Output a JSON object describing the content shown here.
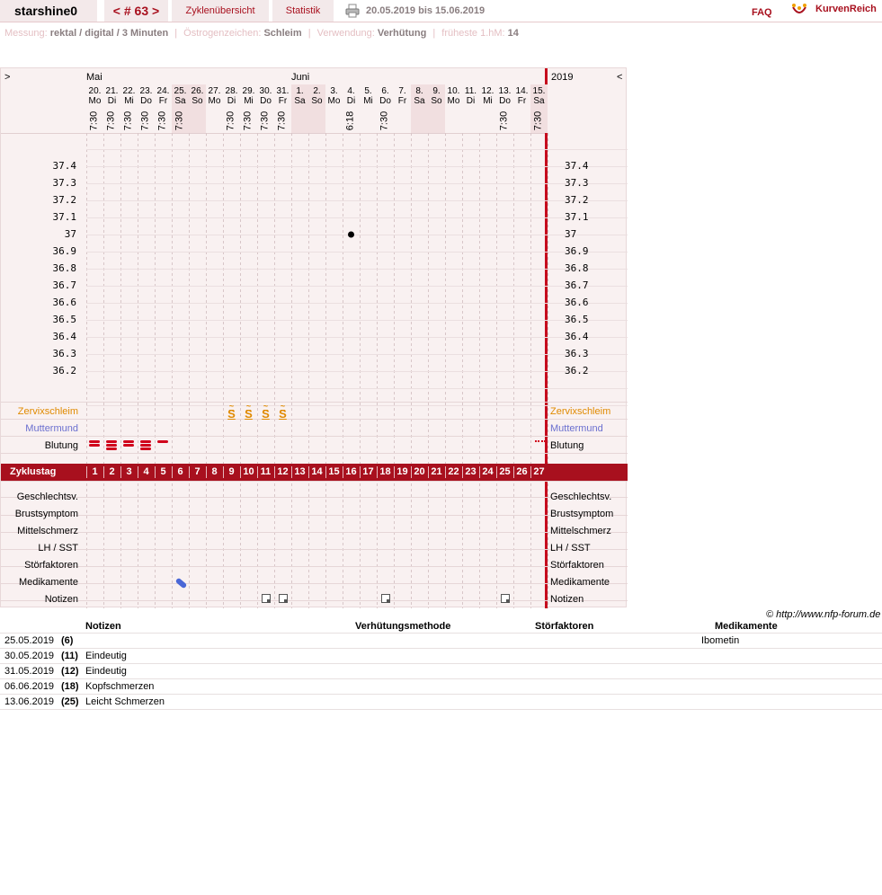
{
  "header": {
    "user": "starshine0",
    "cycle_label": "< # 63 >",
    "overview_tab": "Zyklenübersicht",
    "stats_tab": "Statistik",
    "date_range": "20.05.2019 bis 15.06.2019",
    "faq": "FAQ",
    "brand": "KurvenReich"
  },
  "info": {
    "measurement_label": "Messung:",
    "measurement_value": "rektal / digital / 3 Minuten",
    "estrogen_label": "Östrogenzeichen:",
    "estrogen_value": "Schleim",
    "usage_label": "Verwendung:",
    "usage_value": "Verhütung",
    "earliest_label": "früheste 1.hM:",
    "earliest_value": "14"
  },
  "chart": {
    "nav_prev": ">",
    "nav_next": "<",
    "months": [
      "Mai",
      "Juni"
    ],
    "year": "2019",
    "days": [
      {
        "d": "20.",
        "w": "Mo",
        "t": "7:30",
        "we": false
      },
      {
        "d": "21.",
        "w": "Di",
        "t": "7:30",
        "we": false
      },
      {
        "d": "22.",
        "w": "Mi",
        "t": "7:30",
        "we": false
      },
      {
        "d": "23.",
        "w": "Do",
        "t": "7:30",
        "we": false
      },
      {
        "d": "24.",
        "w": "Fr",
        "t": "7:30",
        "we": false
      },
      {
        "d": "25.",
        "w": "Sa",
        "t": "7:30",
        "we": true
      },
      {
        "d": "26.",
        "w": "So",
        "t": "",
        "we": true
      },
      {
        "d": "27.",
        "w": "Mo",
        "t": "",
        "we": false
      },
      {
        "d": "28.",
        "w": "Di",
        "t": "7:30",
        "we": false
      },
      {
        "d": "29.",
        "w": "Mi",
        "t": "7:30",
        "we": false
      },
      {
        "d": "30.",
        "w": "Do",
        "t": "7:30",
        "we": false
      },
      {
        "d": "31.",
        "w": "Fr",
        "t": "7:30",
        "we": false
      },
      {
        "d": "1.",
        "w": "Sa",
        "t": "",
        "we": true
      },
      {
        "d": "2.",
        "w": "So",
        "t": "",
        "we": true
      },
      {
        "d": "3.",
        "w": "Mo",
        "t": "",
        "we": false
      },
      {
        "d": "4.",
        "w": "Di",
        "t": "6:18",
        "we": false
      },
      {
        "d": "5.",
        "w": "Mi",
        "t": "",
        "we": false
      },
      {
        "d": "6.",
        "w": "Do",
        "t": "7:30",
        "we": false
      },
      {
        "d": "7.",
        "w": "Fr",
        "t": "",
        "we": false
      },
      {
        "d": "8.",
        "w": "Sa",
        "t": "",
        "we": true
      },
      {
        "d": "9.",
        "w": "So",
        "t": "",
        "we": true
      },
      {
        "d": "10.",
        "w": "Mo",
        "t": "",
        "we": false
      },
      {
        "d": "11.",
        "w": "Di",
        "t": "",
        "we": false
      },
      {
        "d": "12.",
        "w": "Mi",
        "t": "",
        "we": false
      },
      {
        "d": "13.",
        "w": "Do",
        "t": "7:30",
        "we": false
      },
      {
        "d": "14.",
        "w": "Fr",
        "t": "",
        "we": false
      },
      {
        "d": "15.",
        "w": "Sa",
        "t": "7:30",
        "we": true
      }
    ],
    "temp_ticks": [
      "37.4",
      "37.3",
      "37.2",
      "37.1",
      "37",
      "36.9",
      "36.8",
      "36.7",
      "36.6",
      "36.5",
      "36.4",
      "36.3",
      "36.2"
    ],
    "temperatures": [
      {
        "day": 16,
        "value": 37.0
      }
    ],
    "cervix_label": "Zervixschleim",
    "cervix_symbol": "S",
    "cervix_days": [
      9,
      10,
      11,
      12
    ],
    "os_label": "Muttermund",
    "bleeding_label": "Blutung",
    "bleeding": [
      {
        "day": 1,
        "level": 2
      },
      {
        "day": 2,
        "level": 3
      },
      {
        "day": 3,
        "level": 2
      },
      {
        "day": 4,
        "level": 3
      },
      {
        "day": 5,
        "level": 1
      },
      {
        "day": 27,
        "level": 0
      }
    ],
    "cycle_day_label": "Zyklustag",
    "bottom_rows": [
      "Geschlechtsv.",
      "Brustsymptom",
      "Mittelschmerz",
      "LH / SST",
      "Störfaktoren",
      "Medikamente",
      "Notizen"
    ],
    "medication_days": [
      6
    ],
    "note_days": [
      11,
      12,
      18,
      25
    ],
    "colors": {
      "accent": "#a8101e",
      "cervix": "#e08a00",
      "os": "#6a6fcf",
      "blood": "#d0021b",
      "pill": "#4a67d6"
    }
  },
  "copyright": "© http://www.nfp-forum.de",
  "notes_table": {
    "headers": [
      "Notizen",
      "Verhütungsmethode",
      "Störfaktoren",
      "Medikamente"
    ],
    "rows": [
      {
        "date": "25.05.2019",
        "day": "(6)",
        "note": "",
        "med": "Ibometin"
      },
      {
        "date": "30.05.2019",
        "day": "(11)",
        "note": "Eindeutig",
        "med": ""
      },
      {
        "date": "31.05.2019",
        "day": "(12)",
        "note": "Eindeutig",
        "med": ""
      },
      {
        "date": "06.06.2019",
        "day": "(18)",
        "note": "Kopfschmerzen",
        "med": ""
      },
      {
        "date": "13.06.2019",
        "day": "(25)",
        "note": "Leicht Schmerzen",
        "med": ""
      }
    ]
  }
}
